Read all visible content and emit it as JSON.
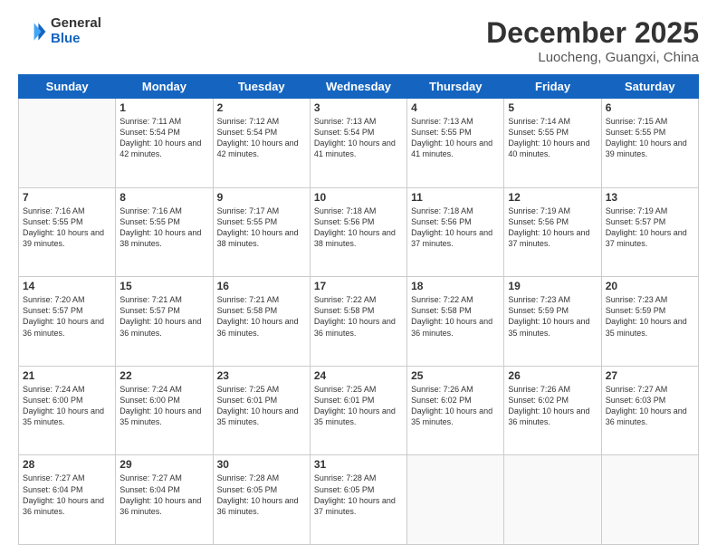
{
  "logo": {
    "general": "General",
    "blue": "Blue"
  },
  "header": {
    "month": "December 2025",
    "location": "Luocheng, Guangxi, China"
  },
  "weekdays": [
    "Sunday",
    "Monday",
    "Tuesday",
    "Wednesday",
    "Thursday",
    "Friday",
    "Saturday"
  ],
  "weeks": [
    [
      {
        "day": "",
        "sunrise": "",
        "sunset": "",
        "daylight": ""
      },
      {
        "day": "1",
        "sunrise": "7:11 AM",
        "sunset": "5:54 PM",
        "daylight": "10 hours and 42 minutes."
      },
      {
        "day": "2",
        "sunrise": "7:12 AM",
        "sunset": "5:54 PM",
        "daylight": "10 hours and 42 minutes."
      },
      {
        "day": "3",
        "sunrise": "7:13 AM",
        "sunset": "5:54 PM",
        "daylight": "10 hours and 41 minutes."
      },
      {
        "day": "4",
        "sunrise": "7:13 AM",
        "sunset": "5:55 PM",
        "daylight": "10 hours and 41 minutes."
      },
      {
        "day": "5",
        "sunrise": "7:14 AM",
        "sunset": "5:55 PM",
        "daylight": "10 hours and 40 minutes."
      },
      {
        "day": "6",
        "sunrise": "7:15 AM",
        "sunset": "5:55 PM",
        "daylight": "10 hours and 39 minutes."
      }
    ],
    [
      {
        "day": "7",
        "sunrise": "7:16 AM",
        "sunset": "5:55 PM",
        "daylight": "10 hours and 39 minutes."
      },
      {
        "day": "8",
        "sunrise": "7:16 AM",
        "sunset": "5:55 PM",
        "daylight": "10 hours and 38 minutes."
      },
      {
        "day": "9",
        "sunrise": "7:17 AM",
        "sunset": "5:55 PM",
        "daylight": "10 hours and 38 minutes."
      },
      {
        "day": "10",
        "sunrise": "7:18 AM",
        "sunset": "5:56 PM",
        "daylight": "10 hours and 38 minutes."
      },
      {
        "day": "11",
        "sunrise": "7:18 AM",
        "sunset": "5:56 PM",
        "daylight": "10 hours and 37 minutes."
      },
      {
        "day": "12",
        "sunrise": "7:19 AM",
        "sunset": "5:56 PM",
        "daylight": "10 hours and 37 minutes."
      },
      {
        "day": "13",
        "sunrise": "7:19 AM",
        "sunset": "5:57 PM",
        "daylight": "10 hours and 37 minutes."
      }
    ],
    [
      {
        "day": "14",
        "sunrise": "7:20 AM",
        "sunset": "5:57 PM",
        "daylight": "10 hours and 36 minutes."
      },
      {
        "day": "15",
        "sunrise": "7:21 AM",
        "sunset": "5:57 PM",
        "daylight": "10 hours and 36 minutes."
      },
      {
        "day": "16",
        "sunrise": "7:21 AM",
        "sunset": "5:58 PM",
        "daylight": "10 hours and 36 minutes."
      },
      {
        "day": "17",
        "sunrise": "7:22 AM",
        "sunset": "5:58 PM",
        "daylight": "10 hours and 36 minutes."
      },
      {
        "day": "18",
        "sunrise": "7:22 AM",
        "sunset": "5:58 PM",
        "daylight": "10 hours and 36 minutes."
      },
      {
        "day": "19",
        "sunrise": "7:23 AM",
        "sunset": "5:59 PM",
        "daylight": "10 hours and 35 minutes."
      },
      {
        "day": "20",
        "sunrise": "7:23 AM",
        "sunset": "5:59 PM",
        "daylight": "10 hours and 35 minutes."
      }
    ],
    [
      {
        "day": "21",
        "sunrise": "7:24 AM",
        "sunset": "6:00 PM",
        "daylight": "10 hours and 35 minutes."
      },
      {
        "day": "22",
        "sunrise": "7:24 AM",
        "sunset": "6:00 PM",
        "daylight": "10 hours and 35 minutes."
      },
      {
        "day": "23",
        "sunrise": "7:25 AM",
        "sunset": "6:01 PM",
        "daylight": "10 hours and 35 minutes."
      },
      {
        "day": "24",
        "sunrise": "7:25 AM",
        "sunset": "6:01 PM",
        "daylight": "10 hours and 35 minutes."
      },
      {
        "day": "25",
        "sunrise": "7:26 AM",
        "sunset": "6:02 PM",
        "daylight": "10 hours and 35 minutes."
      },
      {
        "day": "26",
        "sunrise": "7:26 AM",
        "sunset": "6:02 PM",
        "daylight": "10 hours and 36 minutes."
      },
      {
        "day": "27",
        "sunrise": "7:27 AM",
        "sunset": "6:03 PM",
        "daylight": "10 hours and 36 minutes."
      }
    ],
    [
      {
        "day": "28",
        "sunrise": "7:27 AM",
        "sunset": "6:04 PM",
        "daylight": "10 hours and 36 minutes."
      },
      {
        "day": "29",
        "sunrise": "7:27 AM",
        "sunset": "6:04 PM",
        "daylight": "10 hours and 36 minutes."
      },
      {
        "day": "30",
        "sunrise": "7:28 AM",
        "sunset": "6:05 PM",
        "daylight": "10 hours and 36 minutes."
      },
      {
        "day": "31",
        "sunrise": "7:28 AM",
        "sunset": "6:05 PM",
        "daylight": "10 hours and 37 minutes."
      },
      {
        "day": "",
        "sunrise": "",
        "sunset": "",
        "daylight": ""
      },
      {
        "day": "",
        "sunrise": "",
        "sunset": "",
        "daylight": ""
      },
      {
        "day": "",
        "sunrise": "",
        "sunset": "",
        "daylight": ""
      }
    ]
  ]
}
